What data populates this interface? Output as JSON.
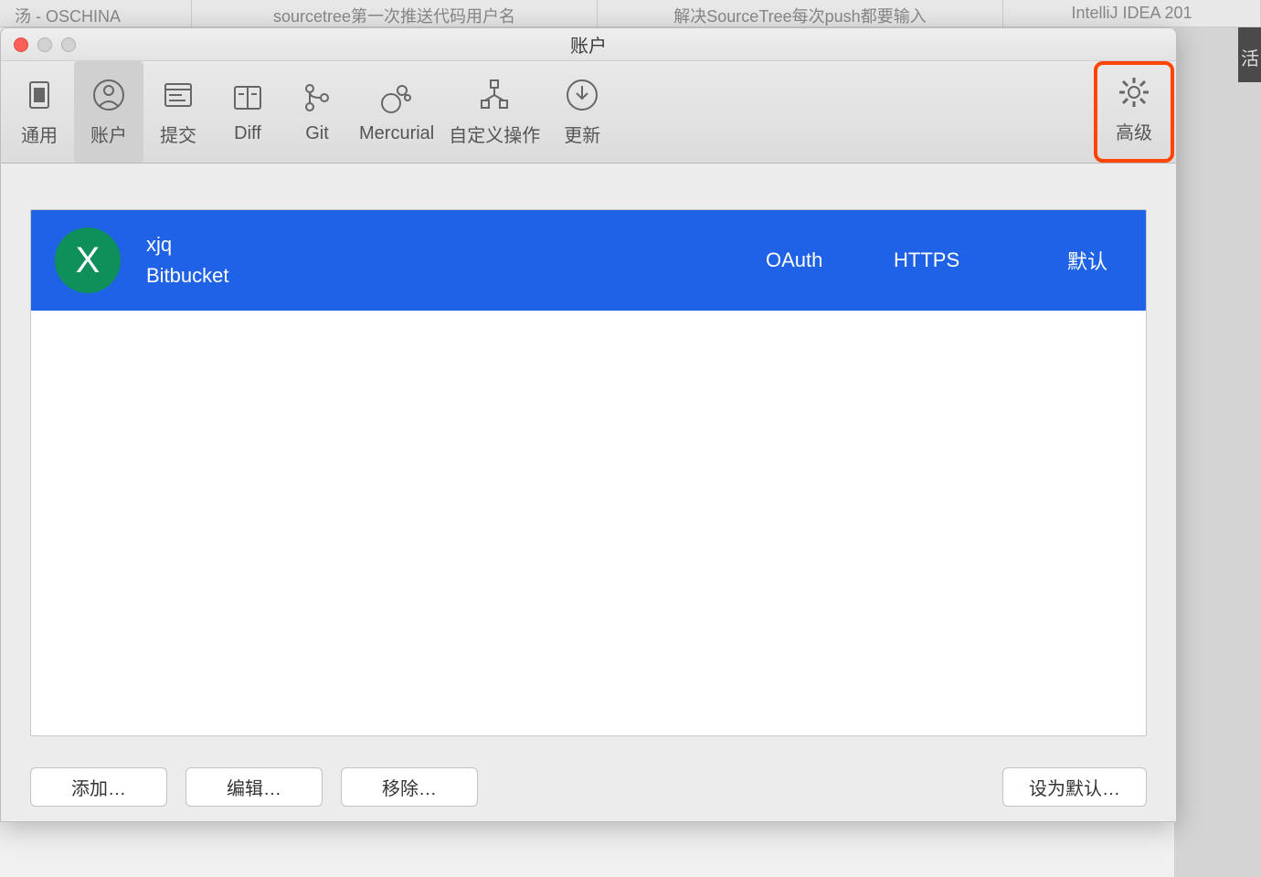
{
  "background_tabs": [
    "汤 - OSCHINA",
    "sourcetree第一次推送代码用户名",
    "解决SourceTree每次push都要输入",
    "IntelliJ IDEA 201"
  ],
  "bg_side_char": "活",
  "window_title": "账户",
  "toolbar": {
    "general": "通用",
    "accounts": "账户",
    "commit": "提交",
    "diff": "Diff",
    "git": "Git",
    "mercurial": "Mercurial",
    "custom": "自定义操作",
    "update": "更新",
    "advanced": "高级"
  },
  "account": {
    "avatar_letter": "X",
    "username": "xjq",
    "service": "Bitbucket",
    "auth": "OAuth",
    "protocol": "HTTPS",
    "default_label": "默认"
  },
  "buttons": {
    "add": "添加…",
    "edit": "编辑…",
    "remove": "移除…",
    "set_default": "设为默认…"
  }
}
